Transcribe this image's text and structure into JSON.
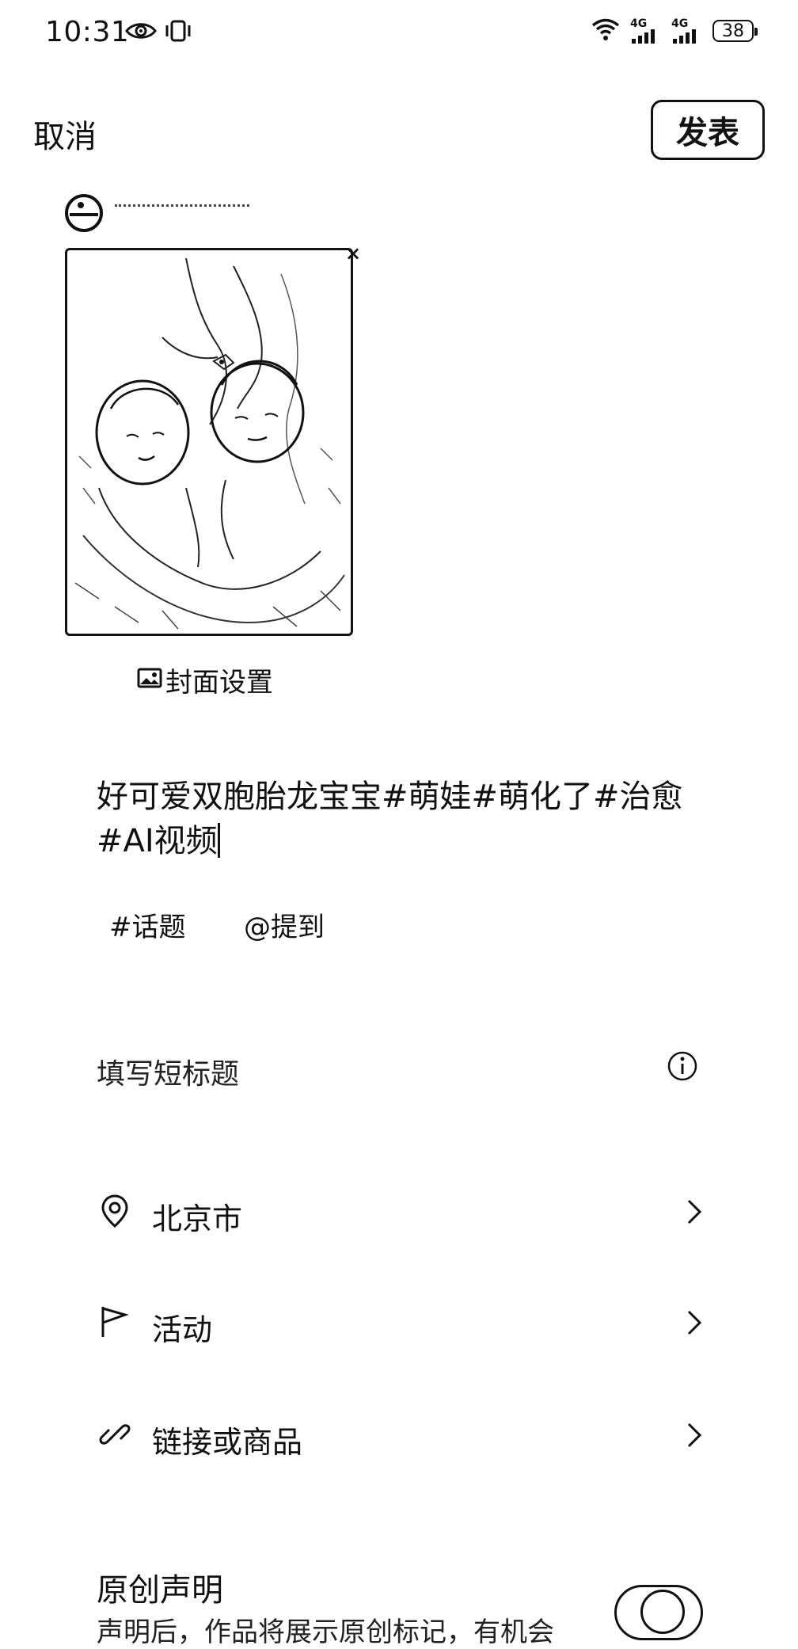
{
  "status_bar": {
    "time": "10:31",
    "network_1": "4G",
    "network_2": "4G",
    "battery": "38",
    "icons": [
      "eye-icon",
      "vibrate-icon",
      "wifi-icon",
      "signal-icon",
      "signal-icon",
      "battery-icon"
    ]
  },
  "header": {
    "cancel_label": "取消",
    "publish_label": "发表"
  },
  "media": {
    "close_glyph": "×",
    "cover_setting_label": "封面设置"
  },
  "description": {
    "text": "好可爱双胞胎龙宝宝#萌娃#萌化了#治愈#AI视频"
  },
  "chips": {
    "topic_label": "#话题",
    "mention_label": "@提到"
  },
  "short_title": {
    "placeholder": "填写短标题"
  },
  "rows": {
    "location": {
      "label": "北京市",
      "icon": "location-pin-icon"
    },
    "activity": {
      "label": "活动",
      "icon": "flag-icon"
    },
    "link": {
      "label": "链接或商品",
      "icon": "link-icon"
    }
  },
  "original": {
    "title": "原创声明",
    "subtitle": "声明后，作品将展示原创标记，有机会",
    "toggle_on": false
  }
}
